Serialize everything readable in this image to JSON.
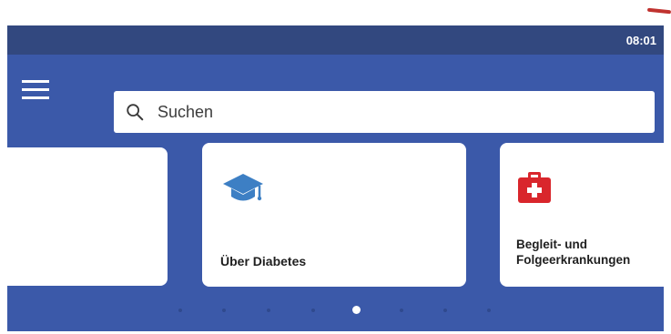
{
  "status_bar": {
    "time": "08:01"
  },
  "app_bar": {
    "menu_icon": "hamburger-menu-icon",
    "search": {
      "placeholder": "Suchen",
      "value": "",
      "icon": "search-icon"
    }
  },
  "carousel": {
    "cards": [
      {
        "label": "",
        "icon": ""
      },
      {
        "label": "Über Diabetes",
        "icon": "graduation-cap-icon"
      },
      {
        "label": "Begleit- und Folgeerkrankungen",
        "icon": "first-aid-kit-icon"
      }
    ],
    "page_count": 8,
    "active_page": 5
  },
  "colors": {
    "background": "#3b59a9",
    "status_bar": "#32487f",
    "education_icon": "#3d7fc4",
    "medical_icon": "#d9262c",
    "active_dot": "#ffffff",
    "inactive_dot": "#2f4a8e"
  }
}
